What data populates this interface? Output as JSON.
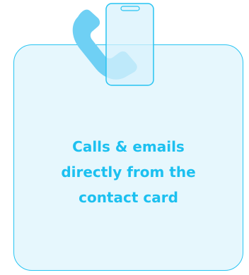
{
  "card": {
    "lines": [
      "Calls & emails",
      "directly from the",
      "contact card"
    ]
  },
  "illustration": {
    "icons": [
      "phone-handset-icon",
      "smartphone-icon"
    ]
  },
  "colors": {
    "accent": "#1cc0f0",
    "handset": "#6fd0f4",
    "card_fill": "#e6f7fd",
    "card_border": "#27c4f2"
  }
}
